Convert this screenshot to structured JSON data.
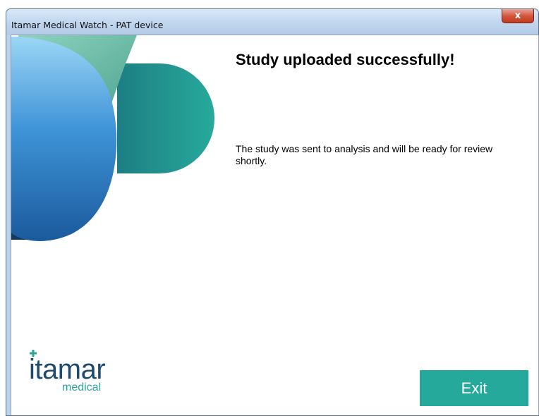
{
  "window": {
    "title": "Itamar Medical Watch - PAT device",
    "close_label": "x"
  },
  "main": {
    "heading": "Study uploaded successfully!",
    "message": "The study was sent to analysis and will be ready for review shortly."
  },
  "logo": {
    "name": "itamar",
    "tagline": "medical"
  },
  "buttons": {
    "exit_label": "Exit"
  },
  "colors": {
    "accent": "#25a99b",
    "brand_blue": "#1e4a6e",
    "brand_teal": "#2aa59b"
  }
}
